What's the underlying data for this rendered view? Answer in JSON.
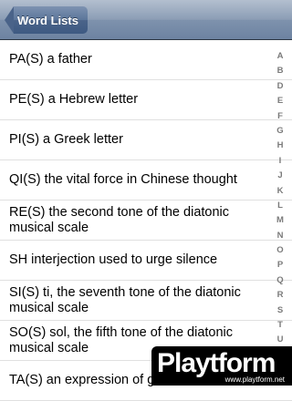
{
  "navbar": {
    "back_label": "Word Lists"
  },
  "rows": [
    "PA(S) a father",
    "PE(S) a Hebrew letter",
    "PI(S) a Greek letter",
    "QI(S) the vital force in Chinese thought",
    "RE(S) the second tone of the diatonic musical scale",
    "SH interjection used to urge silence",
    "SI(S) ti, the seventh tone of the diatonic musical scale",
    "SO(S) sol, the fifth tone of the diatonic musical scale",
    "TA(S) an expression of g"
  ],
  "index_letters": [
    "A",
    "B",
    "D",
    "E",
    "F",
    "G",
    "H",
    "I",
    "J",
    "K",
    "L",
    "M",
    "N",
    "O",
    "P",
    "Q",
    "R",
    "S",
    "T",
    "U"
  ],
  "watermark": {
    "logo": "Playtform",
    "url": "www.playtform.net"
  }
}
